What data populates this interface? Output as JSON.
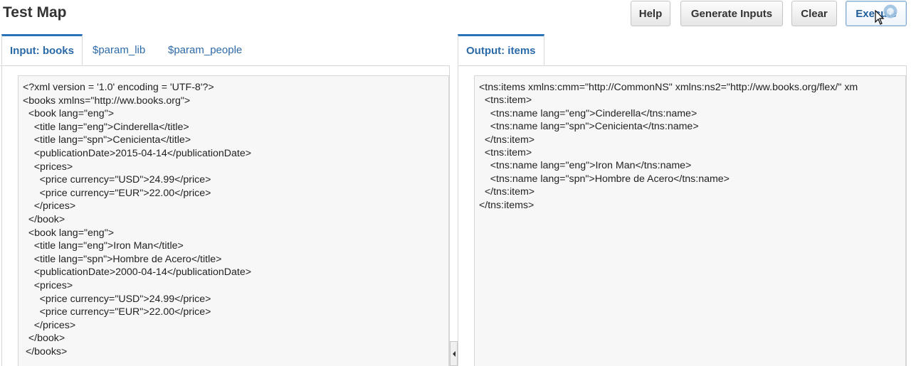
{
  "header": {
    "title": "Test Map",
    "buttons": {
      "help": "Help",
      "generate_inputs": "Generate Inputs",
      "clear": "Clear",
      "execute": "Execute"
    }
  },
  "input_panel": {
    "tabs": [
      "Input: books",
      "$param_lib",
      "$param_people"
    ],
    "active_tab": "Input: books",
    "lines": [
      "<?xml version = '1.0' encoding = 'UTF-8'?>",
      "<books xmlns=\"http://ww.books.org\">",
      "  <book lang=\"eng\">",
      "    <title lang=\"eng\">Cinderella</title>",
      "    <title lang=\"spn\">Cenicienta</title>",
      "    <publicationDate>2015-04-14</publicationDate>",
      "    <prices>",
      "      <price currency=\"USD\">24.99</price>",
      "      <price currency=\"EUR\">22.00</price>",
      "    </prices>",
      "  </book>",
      "  <book lang=\"eng\">",
      "    <title lang=\"eng\">Iron Man</title>",
      "    <title lang=\"spn\">Hombre de Acero</title>",
      "    <publicationDate>2000-04-14</publicationDate>",
      "    <prices>",
      "      <price currency=\"USD\">24.99</price>",
      "      <price currency=\"EUR\">22.00</price>",
      "    </prices>",
      "  </book>",
      " </books>"
    ]
  },
  "output_panel": {
    "tabs": [
      "Output: items"
    ],
    "active_tab": "Output: items",
    "lines": [
      "<tns:items xmlns:cmm=\"http://CommonNS\" xmlns:ns2=\"http://ww.books.org/flex/\" xm",
      "  <tns:item>",
      "    <tns:name lang=\"eng\">Cinderella</tns:name>",
      "    <tns:name lang=\"spn\">Cenicienta</tns:name>",
      "  </tns:item>",
      "  <tns:item>",
      "    <tns:name lang=\"eng\">Iron Man</tns:name>",
      "    <tns:name lang=\"spn\">Hombre de Acero</tns:name>",
      "  </tns:item>",
      "</tns:items>"
    ]
  }
}
